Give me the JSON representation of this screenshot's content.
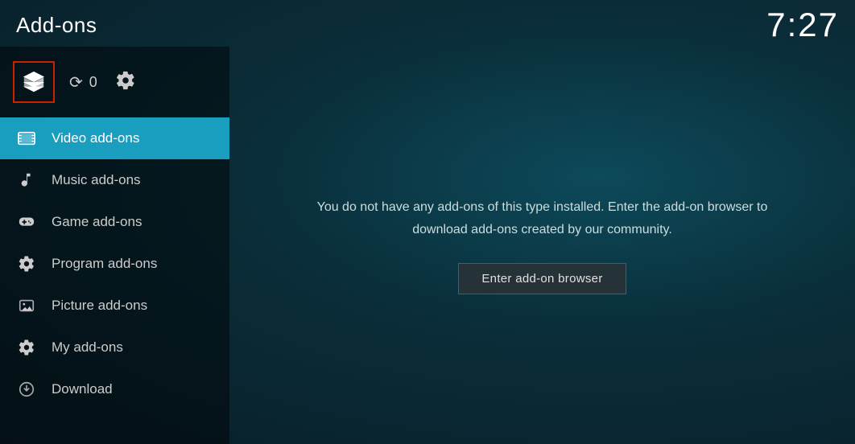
{
  "header": {
    "title": "Add-ons",
    "time": "7:27"
  },
  "sidebar": {
    "update_count": "0",
    "items": [
      {
        "id": "video",
        "label": "Video add-ons",
        "active": true
      },
      {
        "id": "music",
        "label": "Music add-ons",
        "active": false
      },
      {
        "id": "game",
        "label": "Game add-ons",
        "active": false
      },
      {
        "id": "program",
        "label": "Program add-ons",
        "active": false
      },
      {
        "id": "picture",
        "label": "Picture add-ons",
        "active": false
      },
      {
        "id": "myaddon",
        "label": "My add-ons",
        "active": false
      },
      {
        "id": "download",
        "label": "Download",
        "active": false
      }
    ]
  },
  "content": {
    "empty_message": "You do not have any add-ons of this type installed. Enter the add-on browser to download add-ons created by our community.",
    "browser_button": "Enter add-on browser"
  }
}
